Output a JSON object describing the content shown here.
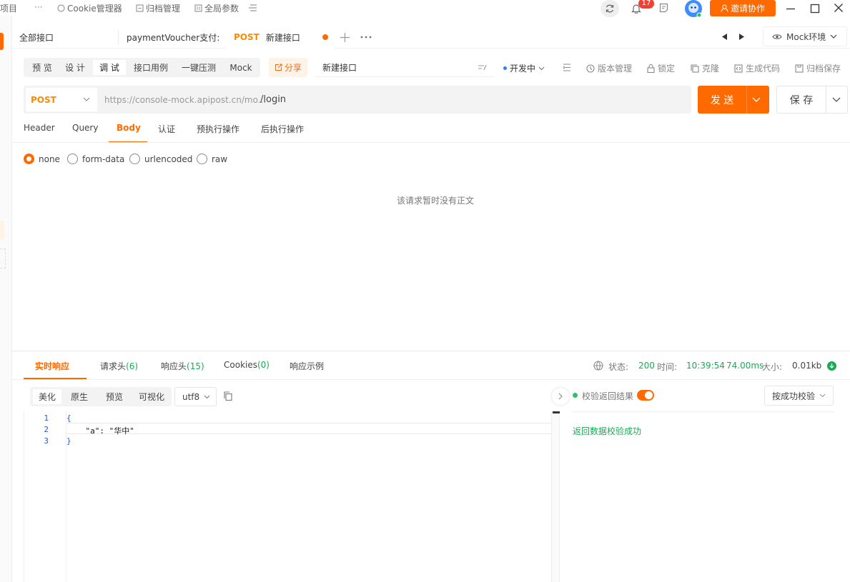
{
  "topbar": {
    "project_label": "项目",
    "more": "···",
    "cookie_manager": "Cookie管理器",
    "archive_manager": "归档管理",
    "global_params": "全局参数",
    "notification_count": "17",
    "invite_label": "邀请协作"
  },
  "tabs": {
    "all_api": "全部接口",
    "payment_tab": "paymentVoucher支付:",
    "active_method": "POST",
    "active_title": "新建接口",
    "env_label": "Mock环境"
  },
  "modes": {
    "items": [
      "预 览",
      "设 计",
      "调 试",
      "接口用例",
      "一键压测",
      "Mock"
    ],
    "active_index": 2,
    "share": "分享",
    "api_name": "新建接口",
    "status": "开发中",
    "status_color": "#2d7ff9",
    "version": "版本管理",
    "lock": "锁定",
    "clone": "克隆",
    "gen_code": "生成代码",
    "archive_save": "归档保存"
  },
  "request": {
    "method": "POST",
    "base_url": "https://console-mock.apipost.cn/mo...",
    "path": "/login",
    "send": "发 送",
    "save": "保 存"
  },
  "body_tabs": {
    "items": [
      "Header",
      "Query",
      "Body",
      "认证",
      "预执行操作",
      "后执行操作"
    ],
    "active": "Body"
  },
  "body_types": {
    "items": [
      "none",
      "form-data",
      "urlencoded",
      "raw"
    ],
    "selected": "none",
    "empty_text": "该请求暂时没有正文"
  },
  "response": {
    "tabs": {
      "realtime": "实时响应",
      "req_headers": "请求头",
      "req_headers_count": "(6)",
      "resp_headers": "响应头",
      "resp_headers_count": "(15)",
      "cookies": "Cookies",
      "cookies_count": "(0)",
      "example": "响应示例"
    },
    "meta": {
      "status_label": "状态:",
      "status": "200",
      "time_label": "时间:",
      "time": "10:39:54",
      "duration": "74.00ms",
      "size_label": "大小:",
      "size": "0.01kb",
      "accent_color": "#1aaa55"
    },
    "views": [
      "美化",
      "原生",
      "预览",
      "可视化"
    ],
    "active_view": "美化",
    "encoding": "utf8",
    "code_lines": [
      "{",
      "    \"a\": \"华中\"",
      "}"
    ],
    "line_numbers": [
      "1",
      "2",
      "3"
    ],
    "validate_label": "校验返回结果",
    "validate_on": true,
    "validate_mode": "按成功校验",
    "validate_result": "返回数据校验成功"
  },
  "colors": {
    "accent": "#ff6a00",
    "success": "#1aaa55"
  }
}
